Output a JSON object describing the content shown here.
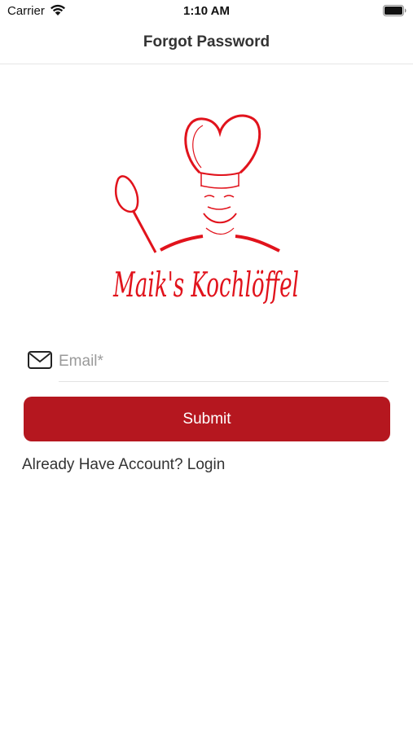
{
  "status_bar": {
    "carrier": "Carrier",
    "time": "1:10 AM",
    "icons": [
      "wifi-icon",
      "battery-icon"
    ]
  },
  "nav": {
    "title": "Forgot Password"
  },
  "logo": {
    "text": "Maik's Kochlöffel",
    "brand_color": "#e1131c"
  },
  "form": {
    "email_placeholder": "Email*",
    "email_value": "",
    "email_icon": "mail-icon",
    "submit_label": "Submit",
    "submit_color": "#b5171f"
  },
  "footer": {
    "login_text": "Already Have Account? Login"
  }
}
